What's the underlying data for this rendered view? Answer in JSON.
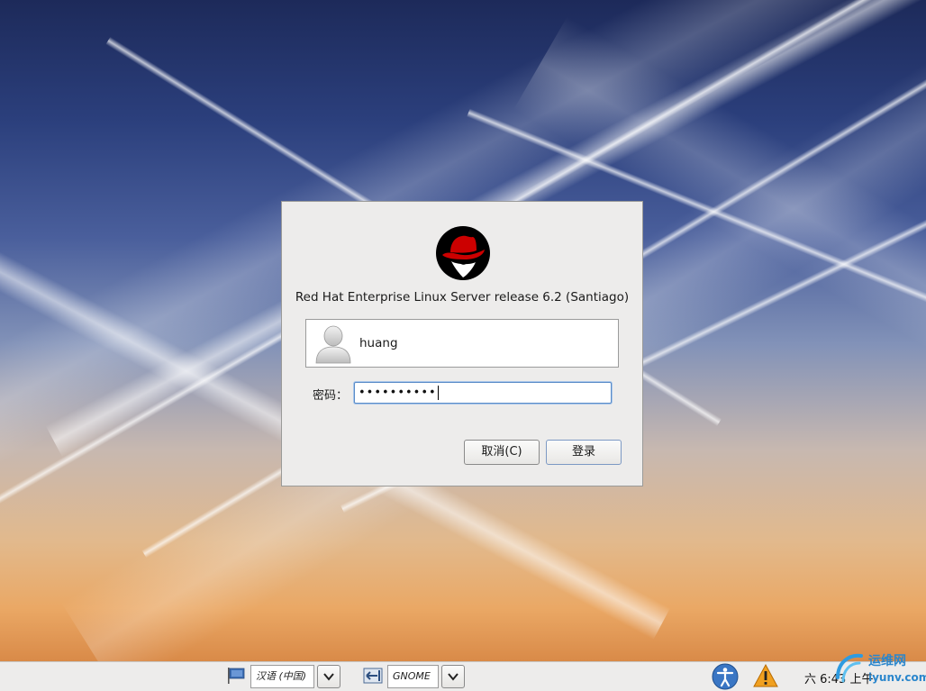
{
  "greeter": {
    "release_text": "Red Hat Enterprise Linux Server release 6.2 (Santiago)",
    "user": {
      "name": "huang"
    },
    "password": {
      "label": "密码：",
      "masked_value": "••••••••••"
    },
    "buttons": {
      "cancel_label": "取消(C)",
      "login_label": "登录"
    }
  },
  "panel": {
    "language": {
      "value": "汉语 (中国)",
      "icon": "flag-icon"
    },
    "session": {
      "value": "GNOME",
      "icon": "session-icon"
    },
    "accessibility_icon": "accessibility-icon",
    "warning_icon": "warning-icon",
    "clock": "六 6:43 上午"
  },
  "watermark": {
    "text": "运维网",
    "subtext": "iyunv.com"
  },
  "colors": {
    "accent": "#5a8cc8",
    "logo_red": "#cc0000",
    "panel_bg": "#edeceb"
  }
}
